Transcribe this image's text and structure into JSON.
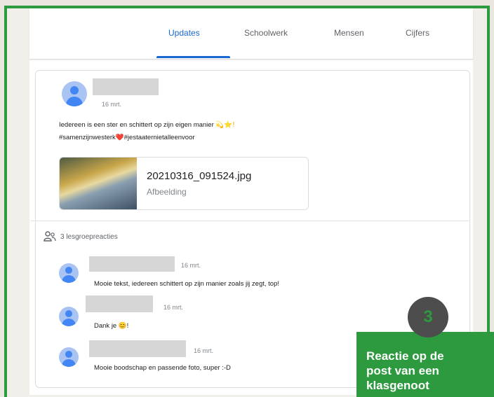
{
  "tabs": [
    {
      "label": "Updates",
      "active": true
    },
    {
      "label": "Schoolwerk",
      "active": false
    },
    {
      "label": "Mensen",
      "active": false
    },
    {
      "label": "Cijfers",
      "active": false
    }
  ],
  "post": {
    "date": "16 mrt.",
    "text_line1": "Iedereen is een ster en schittert op zijn eigen manier",
    "text_line1_emoji": "💫⭐!",
    "text_line2_start": "#samenzijnwesterk",
    "text_line2_heart": "❤️",
    "text_line2_end": "#jestaaternietalleenvoor",
    "attachment": {
      "file_name": "20210316_091524.jpg",
      "file_type": "Afbeelding"
    }
  },
  "comments_header": "3 lesgroepreacties",
  "comments": [
    {
      "date": "16 mrt.",
      "text": "Mooie tekst, iedereen schittert op zijn manier zoals jij zegt, top!"
    },
    {
      "date": "16 mrt.",
      "text": "Dank je 😊!"
    },
    {
      "date": "16 mrt.",
      "text": "Mooie boodschap en passende foto, super :-D"
    }
  ],
  "callout": {
    "badge": "3",
    "text": "Reactie op de\npost van een\nklasgenoot"
  },
  "colors": {
    "accent": "#1967d2",
    "frame_green": "#2e9a3f",
    "avatar_blue": "#4285f4"
  },
  "icons": [
    "people-icon",
    "avatar-icon"
  ]
}
